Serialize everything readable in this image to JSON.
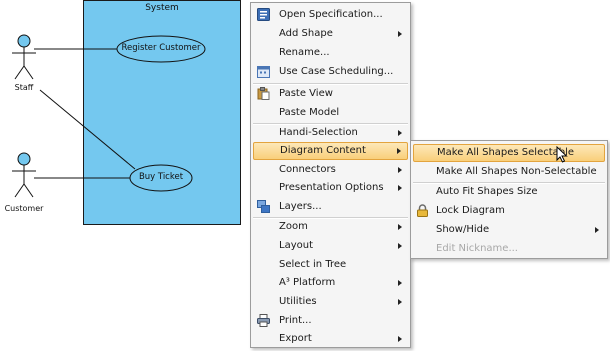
{
  "diagram": {
    "system_title": "System",
    "actors": [
      {
        "name": "Staff"
      },
      {
        "name": "Customer"
      }
    ],
    "use_cases": [
      {
        "name": "Register Customer"
      },
      {
        "name": "Buy Ticket"
      }
    ],
    "colors": {
      "system_fill": "#74c8ef",
      "actor_fill": "#74c8ef",
      "use_case_fill": "#74c8ef"
    }
  },
  "context_menu": {
    "items": [
      {
        "label": "Open Specification...",
        "icon": "specification-icon",
        "submenu": false
      },
      {
        "label": "Add Shape",
        "submenu": true
      },
      {
        "label": "Rename...",
        "submenu": false
      },
      {
        "label": "Use Case Scheduling...",
        "icon": "scheduling-icon",
        "submenu": false
      },
      {
        "label": "Paste View",
        "icon": "paste-icon",
        "submenu": false
      },
      {
        "label": "Paste Model",
        "submenu": false
      },
      {
        "label": "Handi-Selection",
        "submenu": true
      },
      {
        "label": "Diagram Content",
        "submenu": true,
        "highlighted": true
      },
      {
        "label": "Connectors",
        "submenu": true
      },
      {
        "label": "Presentation Options",
        "submenu": true
      },
      {
        "label": "Layers...",
        "icon": "layers-icon",
        "submenu": false
      },
      {
        "label": "Zoom",
        "submenu": true
      },
      {
        "label": "Layout",
        "submenu": true
      },
      {
        "label": "Select in Tree",
        "submenu": false
      },
      {
        "label": "A³ Platform",
        "submenu": true
      },
      {
        "label": "Utilities",
        "submenu": true
      },
      {
        "label": "Print...",
        "icon": "printer-icon",
        "submenu": false
      },
      {
        "label": "Export",
        "submenu": true
      }
    ]
  },
  "submenu": {
    "items": [
      {
        "label": "Make All Shapes Selectable",
        "highlighted": true
      },
      {
        "label": "Make All Shapes Non-Selectable"
      },
      {
        "label": "Auto Fit Shapes Size"
      },
      {
        "label": "Lock Diagram",
        "icon": "lock-icon"
      },
      {
        "label": "Show/Hide",
        "submenu": true
      },
      {
        "label": "Edit Nickname...",
        "disabled": true
      }
    ]
  },
  "colors": {
    "highlight_top": "#fde8b9",
    "highlight_bottom": "#f9cf7a",
    "highlight_border": "#e3a43e",
    "menu_bg": "#f5f5f5"
  }
}
